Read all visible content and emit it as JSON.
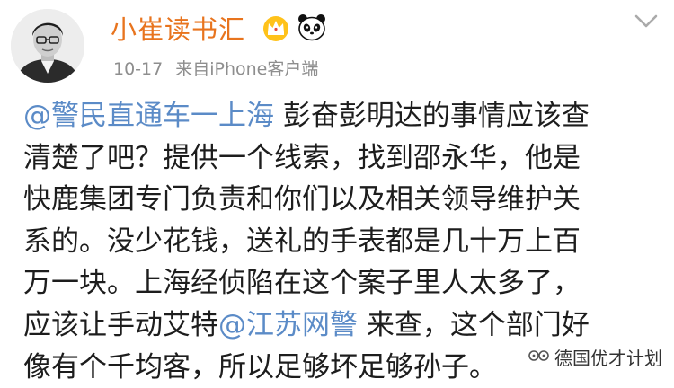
{
  "post": {
    "author": {
      "name": "小崔读书汇",
      "avatar": "avatar-portrait",
      "badges": [
        "crown-icon",
        "panda-icon"
      ]
    },
    "date": "10-17",
    "source": "来自iPhone客户端",
    "lines": [
      {
        "mention": "@警民直通车一上海",
        "text": " 彭奋彭明达的事情应该查"
      },
      {
        "text": "清楚了吧？提供一个线索，找到邵永华，他是"
      },
      {
        "text": "快鹿集团专门负责和你们以及相关领导维护关"
      },
      {
        "text": "系的。没少花钱，送礼的手表都是几十万上百"
      },
      {
        "text": "万一块。上海经侦陷在这个案子里人太多了，"
      },
      {
        "text": "应该让手动艾特",
        "mention": "@江苏网警",
        "after": " 来查，这个部门好"
      },
      {
        "text": "像有个千均客，所以足够坏足够孙子。"
      }
    ]
  },
  "watermark": {
    "icon": "wechat-channel-icon",
    "text": "德国优才计划"
  },
  "colors": {
    "username": "#e8741e",
    "mention": "#5b8bc7",
    "meta": "#8e8e8e",
    "text": "#1d1d1d"
  }
}
